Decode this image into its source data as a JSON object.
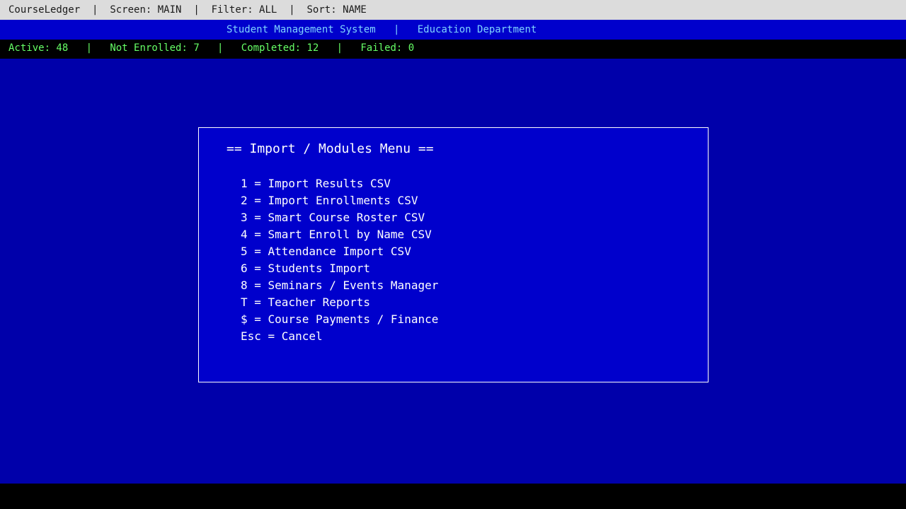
{
  "topbar": {
    "app_name": "CourseLedger",
    "separator": "  |  ",
    "screen": "Screen: MAIN",
    "filter": "Filter: ALL",
    "sort": "Sort: NAME"
  },
  "titlebar": {
    "system": "Student Management System",
    "separator": "   |   ",
    "department": "Education Department"
  },
  "status": {
    "separator": "   |   ",
    "active": "Active: 48",
    "not_enrolled": "Not Enrolled: 7",
    "completed": "Completed: 12",
    "failed": "Failed: 0"
  },
  "menu": {
    "title": "== Import / Modules Menu ==",
    "items": [
      {
        "label": "1 = Import Results CSV"
      },
      {
        "label": "2 = Import Enrollments CSV"
      },
      {
        "label": "3 = Smart Course Roster CSV"
      },
      {
        "label": "4 = Smart Enroll by Name CSV"
      },
      {
        "label": "5 = Attendance Import CSV"
      },
      {
        "label": "6 = Students Import"
      },
      {
        "label": "8 = Seminars / Events Manager"
      },
      {
        "label": "T = Teacher Reports"
      },
      {
        "label": "$ = Course Payments / Finance"
      },
      {
        "label": "Esc = Cancel"
      }
    ]
  },
  "colors": {
    "background": "#0000AA",
    "panel": "#0000CC",
    "status_text": "#66FF66",
    "title_text": "#7FD4FF"
  }
}
